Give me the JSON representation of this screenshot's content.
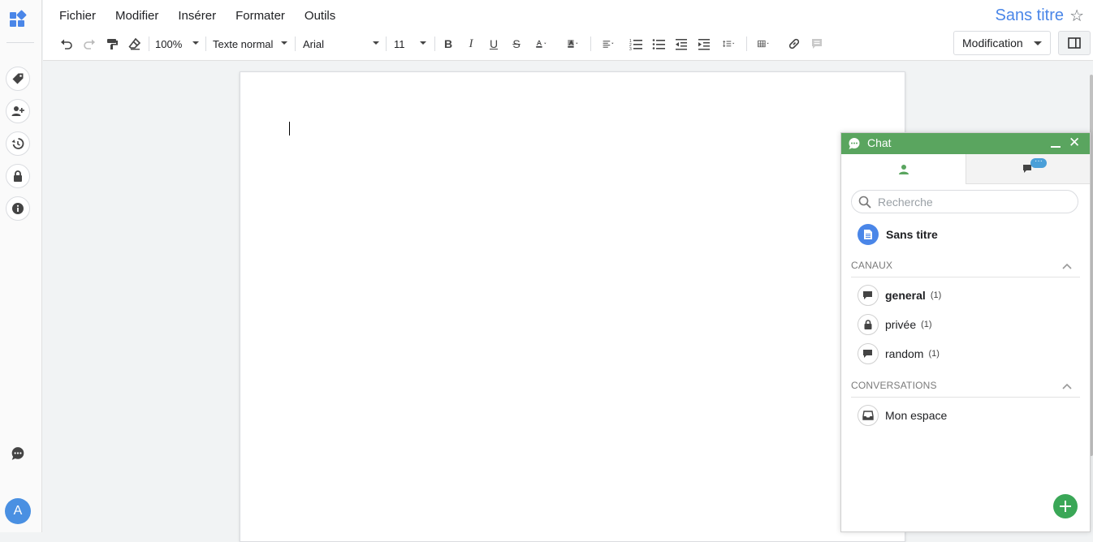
{
  "menu": [
    "Fichier",
    "Modifier",
    "Insérer",
    "Formater",
    "Outils"
  ],
  "document": {
    "title": "Sans titre"
  },
  "toolbar": {
    "zoom": "100%",
    "style": "Texte normal",
    "font": "Arial",
    "size": "11"
  },
  "mode": {
    "label": "Modification"
  },
  "sidebar": {
    "avatar_initial": "A",
    "buttons": [
      "tag-icon",
      "add-user-icon",
      "history-icon",
      "lock-icon",
      "info-icon"
    ]
  },
  "chat": {
    "title": "Chat",
    "unread_badge": "···",
    "search_placeholder": "Recherche",
    "document_label": "Sans titre",
    "channels_heading": "CANAUX",
    "channels": [
      {
        "name": "general",
        "count": "(1)",
        "icon": "chat-bubble-icon",
        "bold": true
      },
      {
        "name": "privée",
        "count": "(1)",
        "icon": "lock-icon",
        "bold": false
      },
      {
        "name": "random",
        "count": "(1)",
        "icon": "chat-bubble-icon",
        "bold": false
      }
    ],
    "conversations_heading": "CONVERSATIONS",
    "conversations": [
      {
        "name": "Mon espace",
        "icon": "inbox-icon"
      }
    ]
  },
  "colors": {
    "chat_header": "#5aa55f",
    "title_blue": "#4a86e8",
    "avatar_blue": "#4a90e2",
    "add_button": "#3aa757"
  }
}
